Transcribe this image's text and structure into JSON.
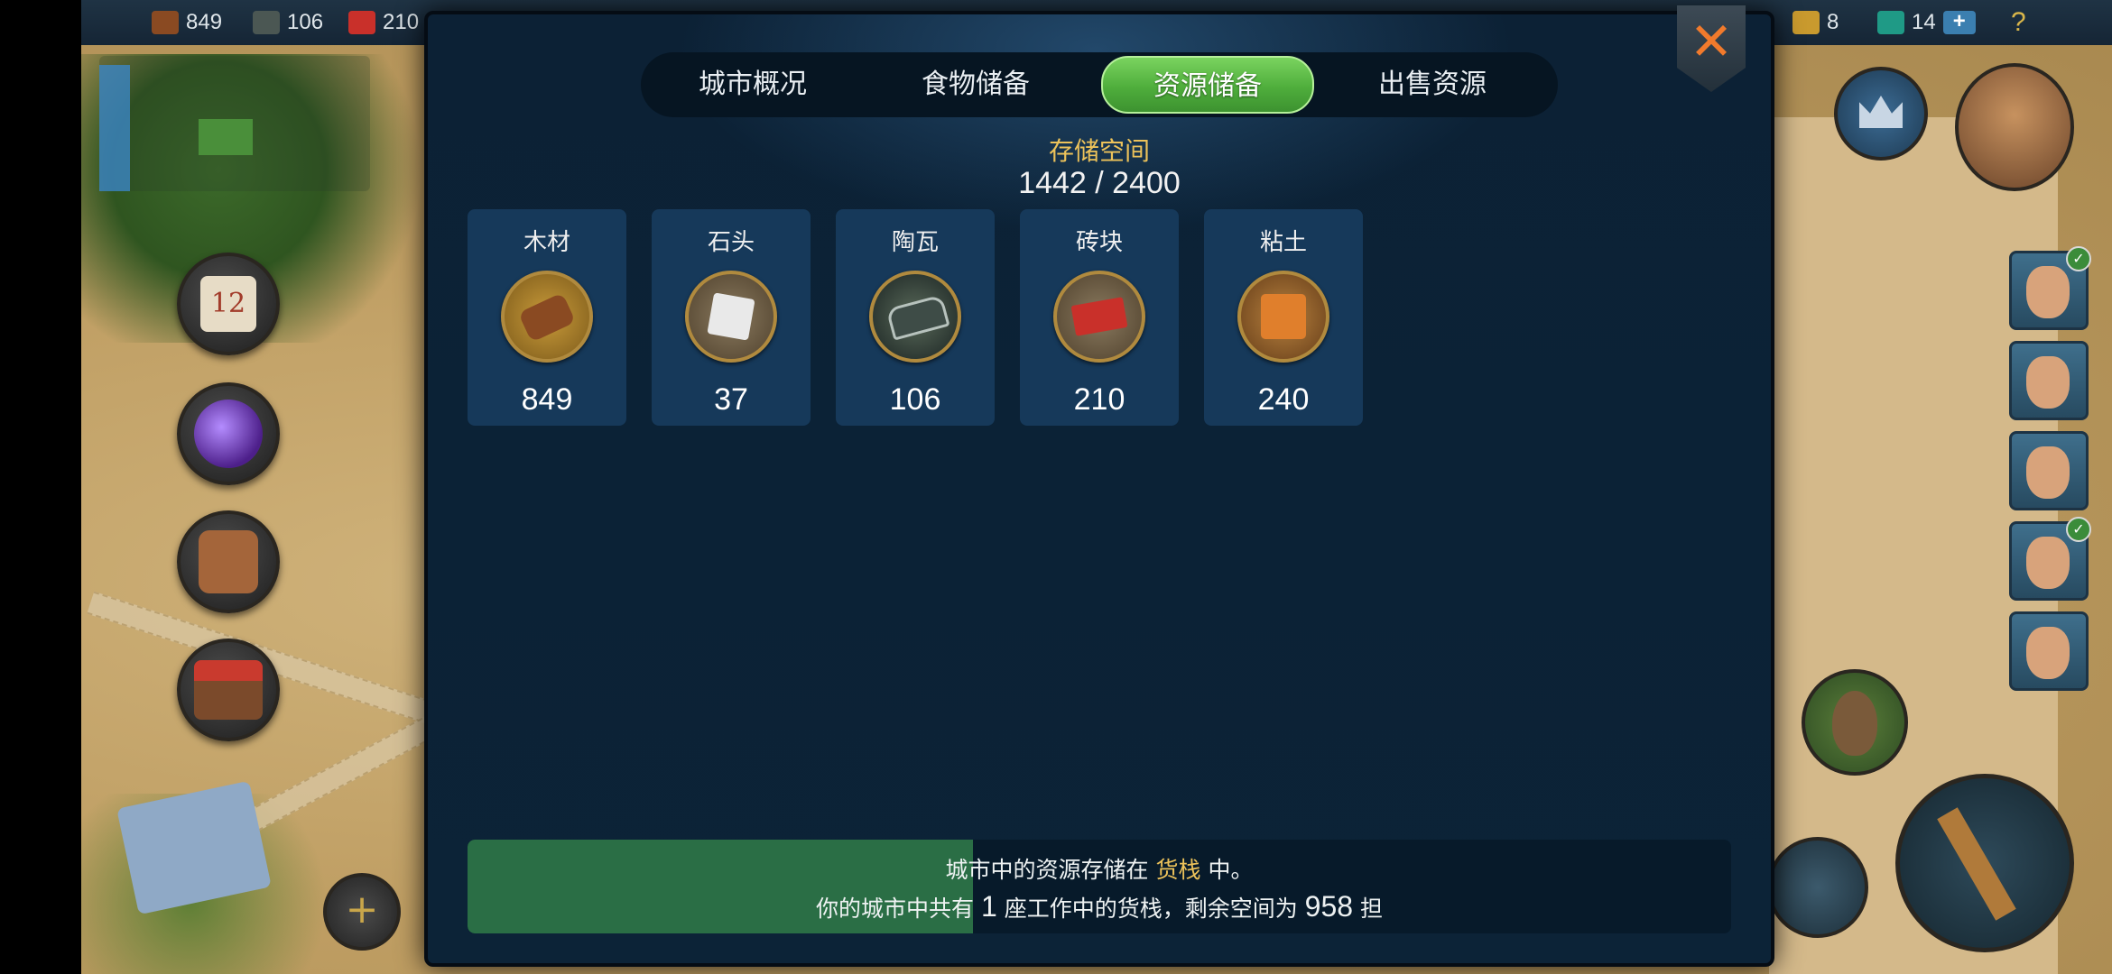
{
  "top_resources": {
    "wood": "849",
    "tile": "106",
    "brick": "210",
    "gold": "8",
    "gems": "14",
    "plus": "+",
    "help": "?"
  },
  "tabs": [
    {
      "label": "城市概况",
      "active": false
    },
    {
      "label": "食物储备",
      "active": false
    },
    {
      "label": "资源储备",
      "active": true
    },
    {
      "label": "出售资源",
      "active": false
    }
  ],
  "storage": {
    "label": "存储空间",
    "value": "1442 / 2400"
  },
  "resources": [
    {
      "name": "木材",
      "value": "849",
      "icon": "wood-logs-icon",
      "color": "#8a4a22"
    },
    {
      "name": "石头",
      "value": "37",
      "icon": "stone-block-icon",
      "color": "#cfcfcf"
    },
    {
      "name": "陶瓦",
      "value": "106",
      "icon": "roof-tile-icon",
      "color": "#2f3a36"
    },
    {
      "name": "砖块",
      "value": "210",
      "icon": "bricks-icon",
      "color": "#c9302a"
    },
    {
      "name": "粘土",
      "value": "240",
      "icon": "clay-block-icon",
      "color": "#d9782a"
    }
  ],
  "info": {
    "line1_a": "城市中的资源存储在",
    "line1_hl": "货栈",
    "line1_b": "中。",
    "line2_a": "你的城市中共有",
    "line2_num1": "1",
    "line2_b": "座工作中的货栈，剩余空间为",
    "line2_num2": "958",
    "line2_c": "担",
    "fill_fraction": 0.4
  },
  "close_label": "✕",
  "side_badges": {
    "calendar_day": "12",
    "add": "+"
  },
  "colors": {
    "accent_gold": "#ecc25a",
    "tab_active": "#4fae3c",
    "panel": "#0b2236",
    "card": "#16395a"
  }
}
